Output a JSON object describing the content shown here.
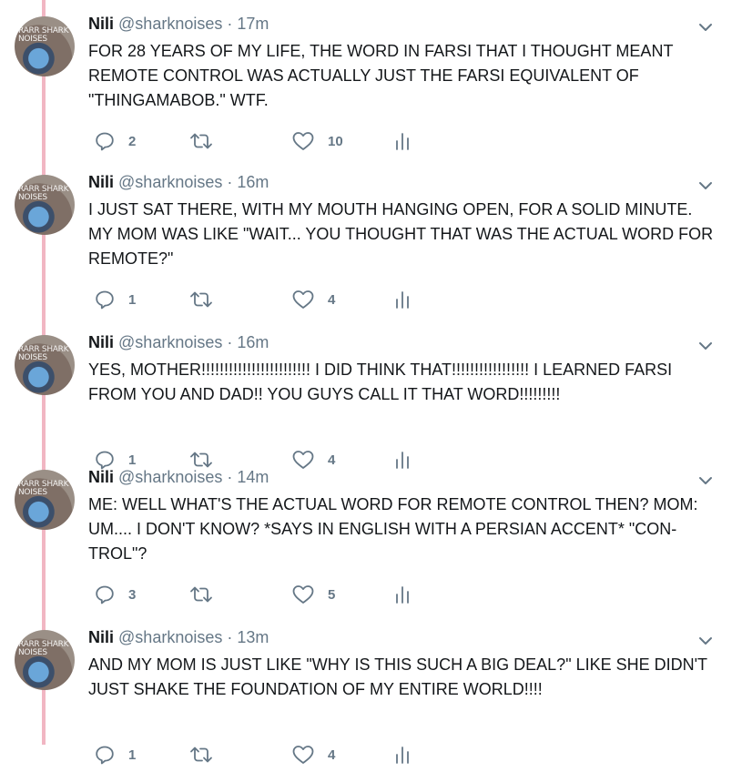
{
  "author": {
    "name": "Nili",
    "handle": "@sharknoises",
    "avatar_text": "RARR SHARK NOISES"
  },
  "separator": "·",
  "tweets": [
    {
      "time": "17m",
      "text": "FOR 28 YEARS OF MY LIFE, THE WORD IN FARSI THAT I THOUGHT MEANT REMOTE CONTROL WAS ACTUALLY JUST THE FARSI EQUIVALENT OF \"THINGAMABOB.\" WTF.",
      "replies": "2",
      "likes": "10"
    },
    {
      "time": "16m",
      "text": "I JUST SAT THERE, WITH MY MOUTH HANGING OPEN, FOR A SOLID MINUTE. MY MOM WAS LIKE \"WAIT... YOU THOUGHT THAT WAS THE ACTUAL WORD FOR REMOTE?\"",
      "replies": "1",
      "likes": "4"
    },
    {
      "time": "16m",
      "text": "YES, MOTHER!!!!!!!!!!!!!!!!!!!!!!!! I DID THINK THAT!!!!!!!!!!!!!!!!! I LEARNED FARSI FROM YOU AND DAD!! YOU GUYS CALL IT THAT WORD!!!!!!!!!",
      "replies": "1",
      "likes": "4"
    },
    {
      "time": "14m",
      "text": "ME: WELL WHAT'S THE ACTUAL WORD FOR REMOTE CONTROL THEN? MOM: UM.... I DON'T KNOW? *SAYS IN ENGLISH WITH A PERSIAN ACCENT* \"CON-TROL\"?",
      "replies": "3",
      "likes": "5"
    },
    {
      "time": "13m",
      "text": "AND MY MOM IS JUST LIKE \"WHY IS THIS SUCH A BIG DEAL?\" LIKE SHE DIDN'T JUST SHAKE THE FOUNDATION OF MY ENTIRE WORLD!!!!",
      "replies": "1",
      "likes": "4"
    }
  ],
  "icons": {
    "reply": "reply-icon",
    "retweet": "retweet-icon",
    "like": "heart-icon",
    "stats": "analytics-icon",
    "menu": "chevron-down-icon"
  },
  "colors": {
    "thread_line": "#f1b6c3",
    "secondary_text": "#657786",
    "primary_text": "#14171a"
  }
}
